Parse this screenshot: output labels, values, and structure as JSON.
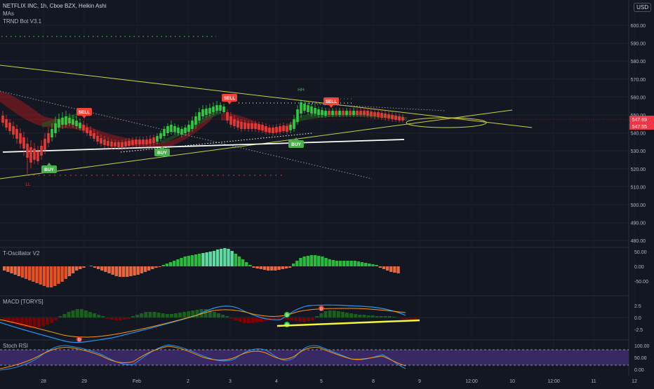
{
  "header": {
    "symbol_line": "NETFLIX INC, 1h, Cboe BZX, Heikin Ashi",
    "indicator_1": "MAs",
    "indicator_2": "TRND Bot V3.1",
    "currency": "USD"
  },
  "price_axis": {
    "ticks": [
      "600.00",
      "590.00",
      "580.00",
      "570.00",
      "560.00",
      "550.00",
      "540.00",
      "530.00",
      "520.00",
      "510.00",
      "500.00",
      "490.00",
      "480.00"
    ],
    "badge_top": "547.69",
    "badge_bottom": "547.55",
    "badge_top_color": "#f23645",
    "badge_bottom_color": "#f23645"
  },
  "time_axis": {
    "labels": [
      "28",
      "29",
      "Feb",
      "2",
      "3",
      "4",
      "5",
      "8",
      "9",
      "12:00",
      "10",
      "12:00",
      "11",
      "12"
    ]
  },
  "signals": {
    "buy": "BUY",
    "sell": "SELL",
    "hh": "HH",
    "ll": "LL",
    "d": "D"
  },
  "panels": {
    "oscillator": {
      "title": "T-Oscillator V2",
      "ticks": [
        "50.00",
        "0.00",
        "-50.00"
      ]
    },
    "macd": {
      "title": "MACD [TORYS]",
      "ticks": [
        "2.5",
        "0.0",
        "-2.5"
      ]
    },
    "stoch": {
      "title": "Stoch RSI",
      "ticks": [
        "100.00",
        "50.00",
        "0.00"
      ]
    }
  },
  "colors": {
    "background": "#131722",
    "up": "#26a69a",
    "bull_green": "#2ecc40",
    "bear_red": "#e53935",
    "sell_label": "#f44336",
    "buy_label": "#4caf50",
    "trend_line": "#c8d43a",
    "support_line": "#ffffff",
    "macd_line": "#2196f3",
    "signal_line": "#ff9800",
    "stoch_band": "#3d2a6b"
  }
}
